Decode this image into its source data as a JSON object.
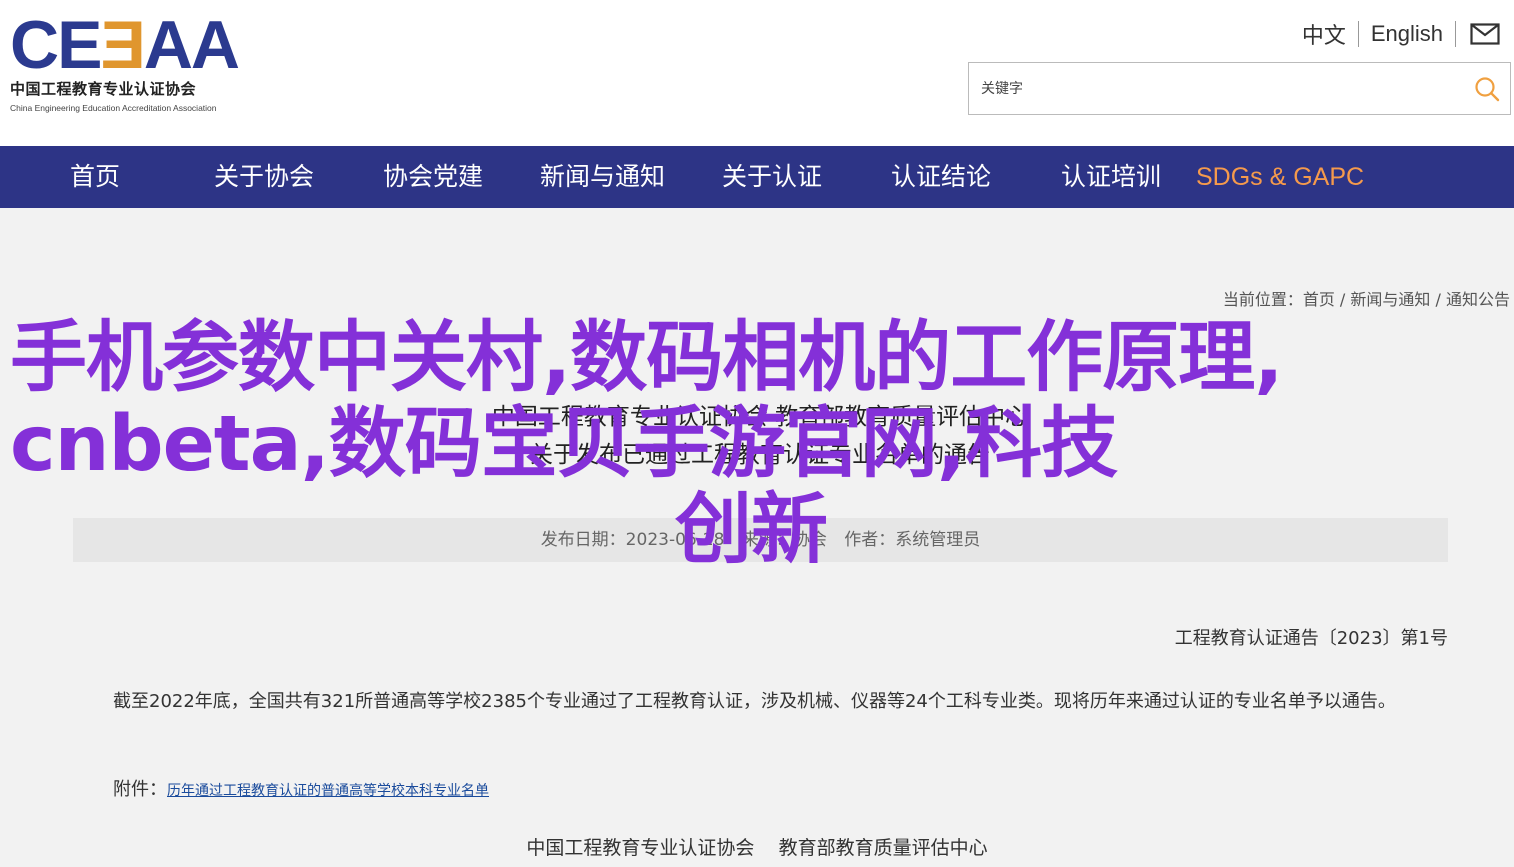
{
  "logo": {
    "mark_a": "CE",
    "mark_b": "Ǝ",
    "mark_c": "AA",
    "name_cn": "中国工程教育专业认证协会",
    "name_en": "China Engineering Education Accreditation Association"
  },
  "lang": {
    "cn": "中文",
    "en": "English"
  },
  "search": {
    "placeholder": "关键字"
  },
  "nav": {
    "items": [
      "首页",
      "关于协会",
      "协会党建",
      "新闻与通知",
      "关于认证",
      "认证结论",
      "认证培训",
      "SDGs & GAPC"
    ]
  },
  "breadcrumb": {
    "prefix": "当前位置：",
    "home": "首页",
    "sep": " / ",
    "section": "新闻与通知",
    "page": "通知公告"
  },
  "article": {
    "title_line1": "中国工程教育专业认证协会 教育部教育质量评估中心",
    "title_line2": "关于发布已通过工程教育认证专业名单的通告",
    "meta_date": "发布日期：2023-06-28",
    "meta_source": "来源：协会",
    "meta_author": "作者：系统管理员",
    "notice_no": "工程教育认证通告〔2023〕第1号",
    "paragraph": "截至2022年底，全国共有321所普通高等学校2385个专业通过了工程教育认证，涉及机械、仪器等24个工科专业类。现将历年来通过认证的专业名单予以通告。",
    "attach_label": "附件：",
    "attach_link": "历年通过工程教育认证的普通高等学校本科专业名单",
    "footer_orgs": "中国工程教育专业认证协会    教育部教育质量评估中心"
  },
  "overlay": {
    "line1": "手机参数中关村,数码相机的工作原理,",
    "line2": "cnbeta,数码宝贝手游官网,科技",
    "line3": "创新"
  },
  "colors": {
    "nav_bg": "#2d3486",
    "nav_highlight": "#f59a4c",
    "overlay_text": "#8430d8",
    "logo_blue": "#2b3a8f",
    "logo_orange": "#e0962e"
  }
}
